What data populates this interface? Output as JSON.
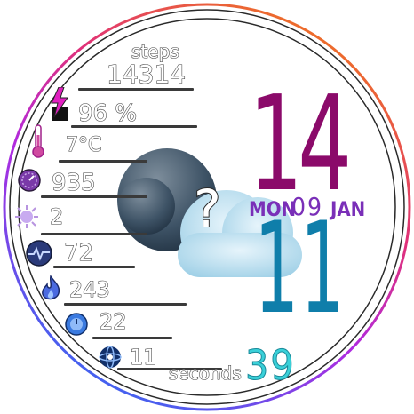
{
  "colors": {
    "ring_top": "#f05a1a",
    "ring_left": "#d8208a",
    "ring_bottom": "#3a6cf0",
    "hour": "#8b0a6a",
    "minute": "#0f7eaa",
    "date": "#7a2fb8",
    "seconds": "#3ad0d8",
    "battery_bolt": "#e020c0"
  },
  "weather": {
    "icon": "unknown-weather-cloud-icon",
    "symbol": "?"
  },
  "stats": {
    "steps_label": "steps",
    "steps_value": "14314",
    "battery_value": "96 %",
    "temperature_value": "7°C",
    "pressure_value": "935",
    "uv_value": "2",
    "heart_rate_value": "72",
    "calories_value": "243",
    "distance_value": "22",
    "floors_value": "11"
  },
  "time": {
    "hour": "14",
    "minute": "11",
    "seconds_label": "seconds",
    "seconds_value": "39"
  },
  "date": {
    "weekday": "MON",
    "day": "09",
    "month": "JAN"
  }
}
